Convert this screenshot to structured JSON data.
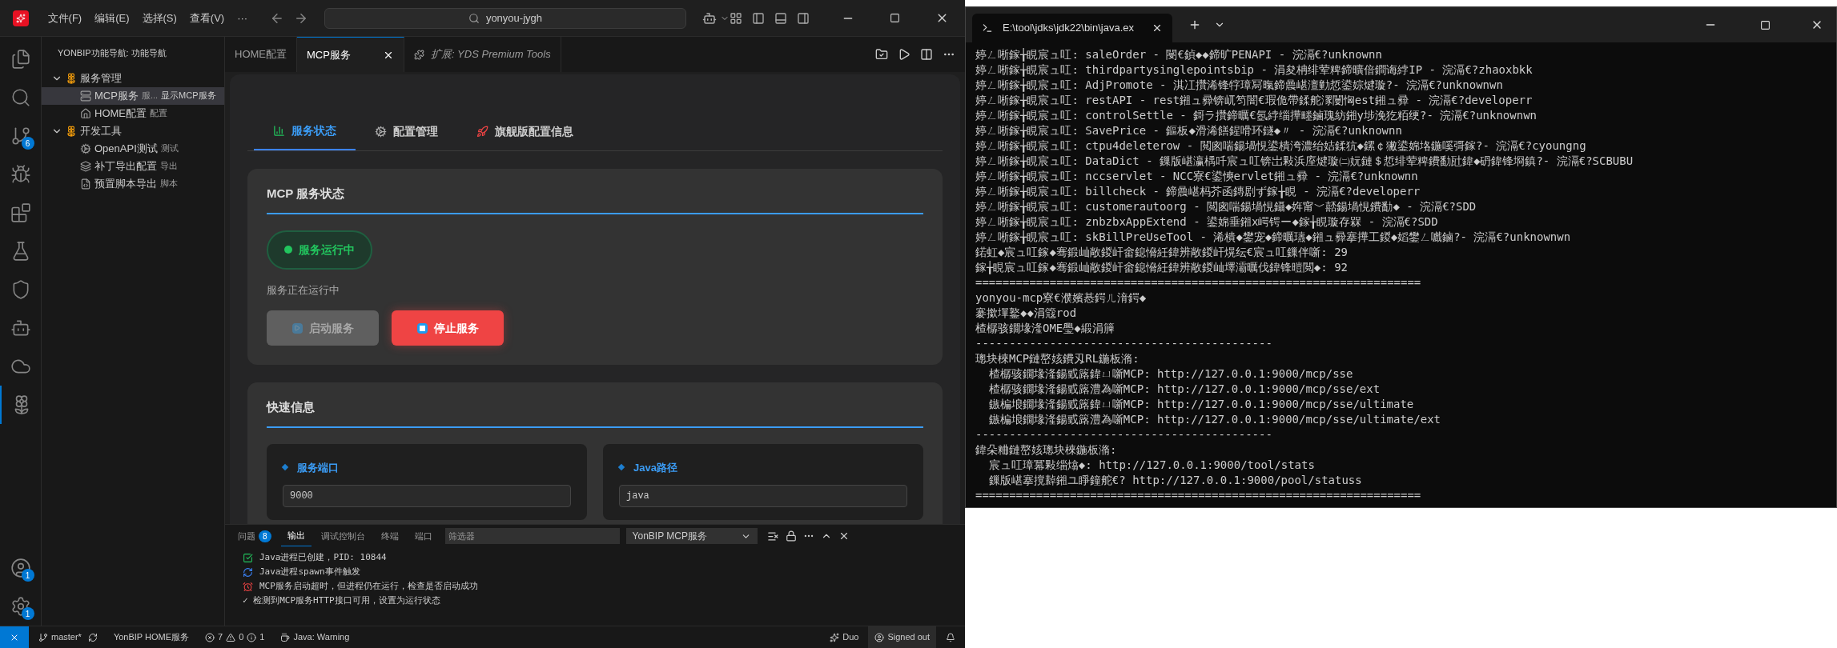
{
  "titlebar": {
    "menus": [
      "文件(F)",
      "编辑(E)",
      "选择(S)",
      "查看(V)",
      "···"
    ],
    "search": "yonyou-jygh"
  },
  "activity_bar": {
    "source_control_badge": "6",
    "accounts_badge": "1",
    "manage_badge": "1"
  },
  "sidebar": {
    "title": "YONBIP功能导航: 功能导航",
    "groups": [
      {
        "label": "服务管理",
        "expanded": true,
        "children": [
          {
            "kind": "mcp",
            "label": "MCP服务",
            "description": "服...",
            "hover_text": "显示MCP服务",
            "selected": true
          },
          {
            "kind": "home",
            "label": "HOME配置",
            "description": "配置",
            "selected": false
          }
        ]
      },
      {
        "label": "开发工具",
        "expanded": true,
        "children": [
          {
            "kind": "api",
            "label": "OpenAPI测试",
            "description": "测试",
            "selected": false
          },
          {
            "kind": "patch",
            "label": "补丁导出配置",
            "description": "导出",
            "selected": false
          },
          {
            "kind": "script",
            "label": "预置脚本导出",
            "description": "脚本",
            "selected": false
          }
        ]
      }
    ]
  },
  "editor_tabs": [
    {
      "label": "HOME配置",
      "selected": false,
      "preview": false
    },
    {
      "label": "MCP服务",
      "selected": true,
      "preview": false
    },
    {
      "label": "扩展: YDS Premium Tools",
      "selected": false,
      "preview": true
    }
  ],
  "page": {
    "nav": [
      {
        "kind": "chart",
        "label": "服务状态",
        "selected": true
      },
      {
        "kind": "gear",
        "label": "配置管理",
        "selected": false
      },
      {
        "kind": "rocket",
        "label": "旗舰版配置信息",
        "selected": false
      }
    ],
    "status_card": {
      "title": "MCP 服务状态",
      "badge": "服务运行中",
      "running": true,
      "message": "服务正在运行中",
      "buttons": [
        {
          "kind": "start",
          "label": "启动服务",
          "disabled": true
        },
        {
          "kind": "stop",
          "label": "停止服务",
          "disabled": false
        }
      ]
    },
    "quick_info": {
      "title": "快速信息",
      "items": [
        {
          "label": "服务端口",
          "value": "9000"
        },
        {
          "label": "Java路径",
          "value": "java"
        }
      ]
    }
  },
  "panel": {
    "tabs": [
      {
        "label": "问题",
        "badge": "8",
        "selected": false
      },
      {
        "label": "输出",
        "selected": true
      },
      {
        "label": "调试控制台",
        "selected": false
      },
      {
        "label": "终端",
        "selected": false
      },
      {
        "label": "端口",
        "selected": false
      }
    ],
    "filter_placeholder": "筛选器",
    "channel": "YonBIP MCP服务",
    "lines": [
      {
        "kind": "check",
        "text": "Java进程已创建，PID: 10844"
      },
      {
        "kind": "refresh",
        "text": "Java进程spawn事件触发"
      },
      {
        "kind": "alarm",
        "text": "MCP服务启动超时，但进程仍在运行，检查是否启动成功"
      },
      {
        "kind": "plain",
        "text": "✓ 检测到MCP服务HTTP接口可用，设置为运行状态"
      }
    ]
  },
  "status_bar": {
    "branch": "master*",
    "workspace": "YonBIP HOME服务",
    "errors": "7",
    "warnings": "0",
    "infos": "1",
    "java": "Java: Warning",
    "duo": "Duo",
    "account": "Signed out"
  },
  "console": {
    "title": "E:\\tool\\jdks\\jdk22\\bin\\java.ex",
    "lines": [
      "婷ㄥ唽鎵╁睍宸ュ叿: saleOrder - 閿€鍞◆◆鍗旷PENAPI - 浣滆€?unknownn",
      "婷ㄥ唽鎵╁睍宸ュ叿: thirdpartysinglepointsbip - 涓夋柟绯荤粺鍗曠偣鐧诲綍IP - 浣滆€?zhaoxbkk",
      "婷ㄥ唽鎵╁睍宸ュ叿: AdjPromote - 淇冮攢浠锋牸璋冩暣鍗曟嵁澶勭悊鍙婃煡璇?- 浣滆€?unknownwn",
      "婷ㄥ唽鎵╁睍宸ュ叿: restAPI - rest鎺ュ彛锛屼笉闇€瑕佹帶鍒舵潈闄恟est鎺ュ彛 - 浣滆€?developerr",
      "婷ㄥ唽鎵╁睍宸ュ叿: controlSettle - 鎶ラ攢鍗曞€氬綍缁撶畻鏀瑰紡鎺у埗浼犵粨绠?- 浣滆€?unknownwn",
      "婷ㄥ唽鎵╁睍宸ュ叿: SavePrice - 鏂板◆滑浠饍鍟嗗环鐩◆〃 - 浣滆€?unknownn",
      "婷ㄥ唽鎵╁睍宸ュ叿: ctpu4deleterow - 閲囪喘鍚堝悓鍙樻洿濃绐姞鍒犺◆鏍￠獙鍙婂垎鍦嗘彁鎵?- 浣滆€?cyoungng",
      "婷ㄥ唽鎵╁睍宸ュ叿: DataDict - 鏁版嵁瀛楀吀宸ュ叿锛岀敤浜庢煡璇㈡妧鏈＄悊绯荤粺鐨勫瓧鍏◆砃鍏锋埛鎮?- 浣滆€?SCBUBU",
      "婷ㄥ唽鎵╁睍宸ュ叿: nccservlet - NCC寮€鍙慡ervlet鎺ュ彛 - 浣滆€?unknownn",
      "婷ㄥ唽鎵╁睍宸ュ叿: billcheck - 鍗曟嵁杩芥函鏄剧ず鎵╁睍 - 浣滆€?developerr",
      "婷ㄥ唽鎵╁睍宸ュ叿: customerautoorg - 閲囪喘鍚堝悓鑷◆姩甯﹀嚭鍚堝悓鐨勫◆ - 浣滆€?SDD",
      "婷ㄥ唽鎵╁睍宸ュ叿: znbzbxAppExtend - 鍙婂垂鎺х崿锷ー◆鎵╁睍璇存槑 - 浣滆€?SDD",
      "婷ㄥ唽鎵╁睍宸ュ叿: skBillPreUseTool - 浠樻◆鐢宠◆鍗曞瓙◆鎺ュ彛搴撶工鍐◆嫍鐢ㄥ嚱鏀?- 浣滆€?unknownwn",
      "鍩虹◆宸ュ叿鎵◆骞鍛屾敞鍐屽畬鎴愶紝鍏辨敞鍐屽熀纭€宸ュ叿鏁伴噺: 29",
      "鎵╁睍宸ュ叿鎵◆骞鍛屾敞鍐屽畬鎴愶紝鍏辨敞鍐屾墿灞曞伐鍏锋暟閲◆: 92",
      "==================================================================",
      "yonyou-mcp寮€濮嬪惎鍔ㄦ湇鍔◆",
      "褰撳墠鐜◆◆涓簆rod",
      "楂樼骇鐗堟湰OME璺◆緞涓簲",
      "--------------------------------------------",
      "璁块棶MCP鏈嶅姟鐨刄RL鍦板潃:",
      "  楂樼骇鐗堟湰鍚戜簬鍏ㄩ噺MCP: http://127.0.0.1:9000/mcp/sse",
      "  楂樼骇鐗堟湰鍚戜簬澧為噺MCP: http://127.0.0.1:9000/mcp/sse/ext",
      "  鏃楄埌鐗堟湰鍚戜簬鍏ㄩ噺MCP: http://127.0.0.1:9000/mcp/sse/ultimate",
      "  鏃楄埌鐗堟湰鍚戜簬澧為噺MCP: http://127.0.0.1:9000/mcp/sse/ultimate/ext",
      "--------------------------------------------",
      "鍏朵粬鏈嶅姟璁块棶鍦板潃:",
      "  宸ュ叿璋冪敤缁熻◆: http://127.0.0.1:9000/tool/stats",
      "  鏁版嵁搴撹繛鎺ユ睜鐘舵€? http://127.0.0.1:9000/pool/statuss",
      "=================================================================="
    ]
  }
}
